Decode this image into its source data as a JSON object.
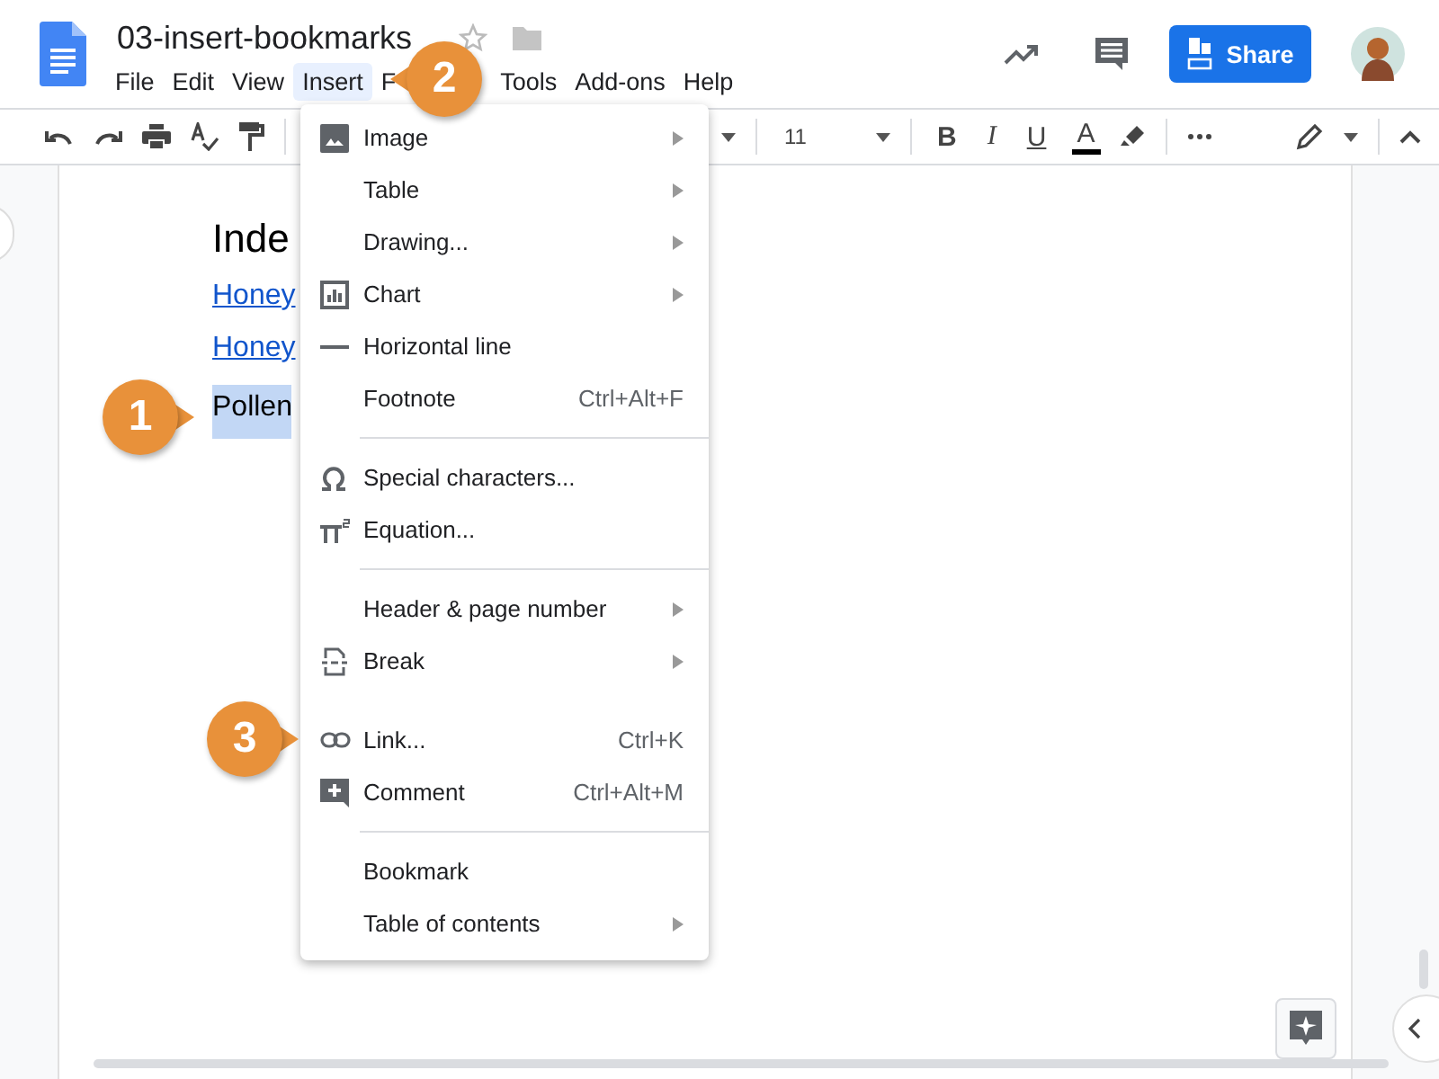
{
  "document": {
    "title": "03-insert-bookmarks"
  },
  "menubar": [
    {
      "label": "File",
      "selected": false
    },
    {
      "label": "Edit",
      "selected": false
    },
    {
      "label": "View",
      "selected": false
    },
    {
      "label": "Insert",
      "selected": true
    },
    {
      "label": "F",
      "selected": false
    },
    {
      "label": "Tools",
      "selected": false
    },
    {
      "label": "Add-ons",
      "selected": false
    },
    {
      "label": "Help",
      "selected": false
    }
  ],
  "share_button": {
    "label": "Share"
  },
  "toolbar": {
    "font_size": "11",
    "format_buttons": [
      "B",
      "I",
      "U",
      "A"
    ]
  },
  "page": {
    "heading": "Inde",
    "links": [
      "Honey",
      "Honey"
    ],
    "selected_text": "Pollen"
  },
  "insert_menu": {
    "sections": [
      {
        "divider": false,
        "items": [
          {
            "label": "Image",
            "submenu": true
          },
          {
            "label": "Table",
            "submenu": true
          },
          {
            "label": "Drawing...",
            "submenu": true
          },
          {
            "label": "Chart",
            "submenu": true
          },
          {
            "label": "Horizontal line",
            "submenu": false
          },
          {
            "label": "Footnote",
            "shortcut": "Ctrl+Alt+F",
            "submenu": false
          }
        ]
      },
      {
        "divider": true,
        "items": [
          {
            "label": "Special characters...",
            "submenu": false
          },
          {
            "label": "Equation...",
            "submenu": false
          }
        ]
      },
      {
        "divider": true,
        "items": [
          {
            "label": "Header & page number",
            "submenu": true
          },
          {
            "label": "Break",
            "submenu": true
          }
        ]
      },
      {
        "divider": false,
        "items": [
          {
            "label": "Link...",
            "shortcut": "Ctrl+K",
            "submenu": false
          },
          {
            "label": "Comment",
            "shortcut": "Ctrl+Alt+M",
            "submenu": false
          }
        ]
      },
      {
        "divider": true,
        "items": [
          {
            "label": "Bookmark",
            "submenu": false
          },
          {
            "label": "Table of contents",
            "submenu": true
          }
        ]
      }
    ]
  },
  "callouts": [
    {
      "number": "1"
    },
    {
      "number": "2"
    },
    {
      "number": "3"
    }
  ]
}
